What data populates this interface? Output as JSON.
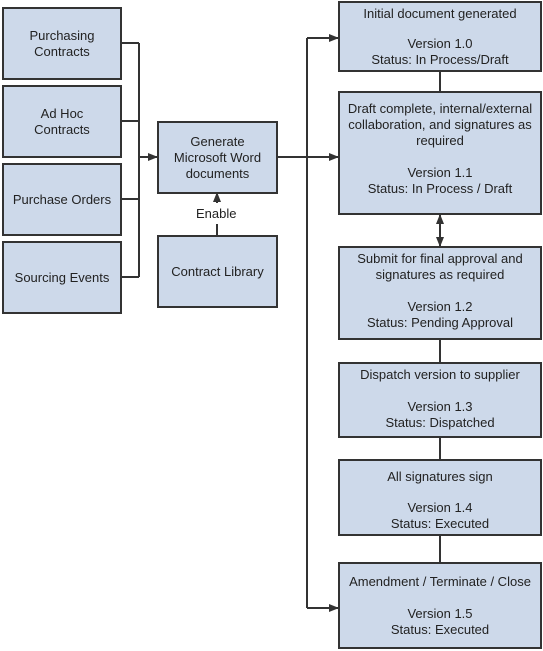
{
  "colors": {
    "box_fill": "#cdd9ea",
    "stroke": "#333333"
  },
  "sources": [
    {
      "label": "Purchasing Contracts"
    },
    {
      "label": "Ad Hoc Contracts"
    },
    {
      "label": "Purchase Orders"
    },
    {
      "label": "Sourcing Events"
    }
  ],
  "generate": {
    "label": "Generate Microsoft Word documents"
  },
  "library": {
    "label": "Contract Library"
  },
  "enable_label": "Enable",
  "stages": [
    {
      "title": "Initial document generated",
      "version": "Version 1.0",
      "status": "Status:  In Process/Draft"
    },
    {
      "title": "Draft complete, internal/external collaboration, and signatures as required",
      "version": "Version 1.1",
      "status": "Status:  In Process / Draft"
    },
    {
      "title": "Submit for final approval and signatures as required",
      "version": "Version 1.2",
      "status": "Status:  Pending Approval"
    },
    {
      "title": "Dispatch version to supplier",
      "version": "Version 1.3",
      "status": "Status:  Dispatched"
    },
    {
      "title": "All signatures sign",
      "version": "Version 1.4",
      "status": "Status:  Executed"
    },
    {
      "title": "Amendment / Terminate / Close",
      "version": "Version 1.5",
      "status": "Status:  Executed"
    }
  ]
}
